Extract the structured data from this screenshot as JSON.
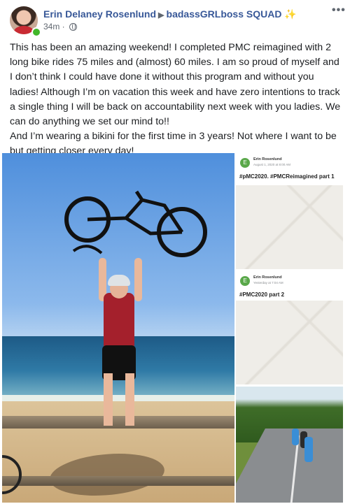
{
  "post": {
    "author": "Erin Delaney Rosenlund",
    "group": "badassGRLboss SQUAD",
    "group_emoji": "✨",
    "time": "34m",
    "more_label": "•••",
    "text": [
      "This has been an amazing weekend! I completed PMC reimagined with 2 long bike rides 75 miles and (almost) 60 miles. I am so proud of myself and I don’t think I could have done it without this program and without you ladies! Although I’m on vacation this week and have zero intentions to track a single thing I will be back on accountability next week with you ladies. We can do anything we set our mind to!!",
      "And I’m wearing a bikini for the first time in 3 years! Not where I want to be but getting closer every day!"
    ]
  },
  "media": {
    "card1": {
      "avatar_letter": "E",
      "name": "Erin Rosenlund",
      "subtitle": "August 1, 2020 at 8:00 AM",
      "title": "#pMC2020. #PMCReimagined part 1"
    },
    "card2": {
      "avatar_letter": "E",
      "name": "Erin Rosenlund",
      "subtitle": "Yesterday at 7:04 AM",
      "title": "#PMC2020 part 2"
    }
  },
  "icons": {
    "globe": "globe-icon",
    "more": "more-options-icon",
    "arrow": "triangle-right-icon"
  },
  "colors": {
    "link": "#385898",
    "online": "#42b72a"
  }
}
